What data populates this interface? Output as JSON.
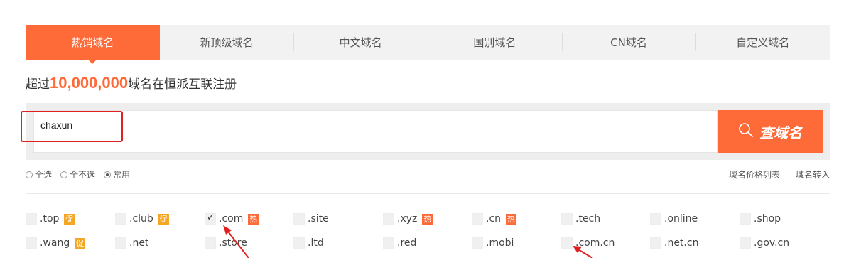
{
  "tabs": [
    {
      "label": "热销域名",
      "active": true
    },
    {
      "label": "新顶级域名",
      "active": false
    },
    {
      "label": "中文域名",
      "active": false
    },
    {
      "label": "国别域名",
      "active": false
    },
    {
      "label": "CN域名",
      "active": false
    },
    {
      "label": "自定义域名",
      "active": false
    }
  ],
  "headline": {
    "prefix": "超过",
    "count": "10,000,000",
    "suffix": "域名在恒派互联注册"
  },
  "search": {
    "value": "chaxun",
    "button_label": "查域名",
    "button_icon": "search-icon"
  },
  "options": {
    "select_all": "全选",
    "select_none": "全不选",
    "common": "常用",
    "selected": "common"
  },
  "links": {
    "price_list": "域名价格列表",
    "transfer": "域名转入"
  },
  "tags": {
    "promo": "促",
    "hot": "热"
  },
  "domains": {
    "row1": [
      {
        "name": ".top",
        "checked": false,
        "tag": "promo"
      },
      {
        "name": ".club",
        "checked": false,
        "tag": "promo"
      },
      {
        "name": ".com",
        "checked": true,
        "tag": "hot"
      },
      {
        "name": ".site",
        "checked": false,
        "tag": ""
      },
      {
        "name": ".xyz",
        "checked": false,
        "tag": "hot"
      },
      {
        "name": ".cn",
        "checked": false,
        "tag": "hot"
      },
      {
        "name": ".tech",
        "checked": false,
        "tag": ""
      },
      {
        "name": ".online",
        "checked": false,
        "tag": ""
      },
      {
        "name": ".shop",
        "checked": false,
        "tag": ""
      }
    ],
    "row2": [
      {
        "name": ".wang",
        "checked": false,
        "tag": "promo"
      },
      {
        "name": ".net",
        "checked": false,
        "tag": ""
      },
      {
        "name": ".store",
        "checked": false,
        "tag": ""
      },
      {
        "name": ".ltd",
        "checked": false,
        "tag": ""
      },
      {
        "name": ".red",
        "checked": false,
        "tag": ""
      },
      {
        "name": ".mobi",
        "checked": false,
        "tag": ""
      },
      {
        "name": ".com.cn",
        "checked": false,
        "tag": ""
      },
      {
        "name": ".net.cn",
        "checked": false,
        "tag": ""
      },
      {
        "name": ".gov.cn",
        "checked": false,
        "tag": ""
      }
    ]
  },
  "colors": {
    "accent": "#ff6a39",
    "highlight_frame": "#e02020",
    "promo_tag": "#f5a623"
  }
}
